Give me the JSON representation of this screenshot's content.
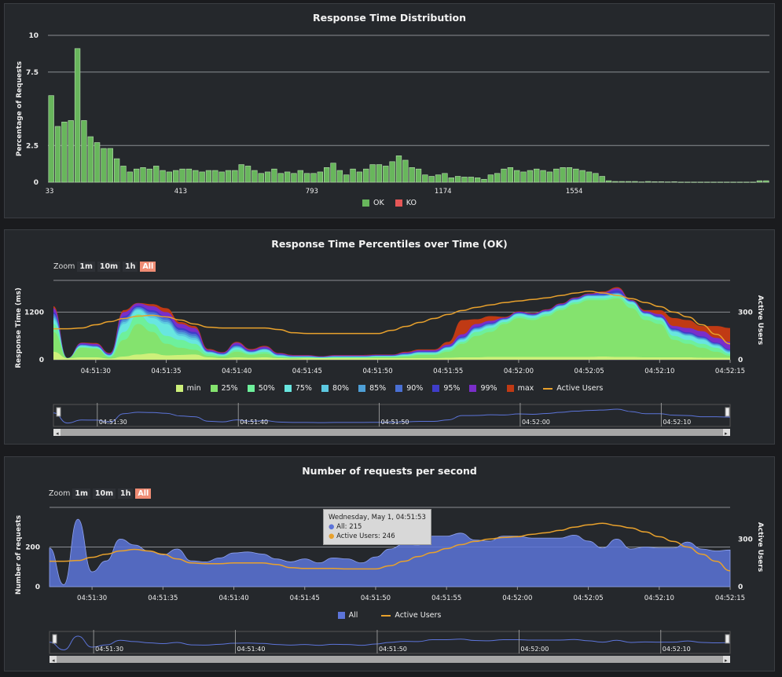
{
  "colors": {
    "ok": "#68b65c",
    "ko": "#e55757",
    "all": "#5c74d9",
    "active": "#e8a12c",
    "min": "#cdf07a",
    "p25": "#84e36e",
    "p50": "#6ef09b",
    "p75": "#68e6e0",
    "p80": "#5cc8e0",
    "p85": "#4e9fd6",
    "p90": "#4a70d4",
    "p95": "#3f3dc9",
    "p99": "#7a2ec9",
    "max": "#c03a14"
  },
  "distribution": {
    "title": "Response Time Distribution",
    "ylabel": "Percentage of Requests",
    "legend": [
      {
        "label": "OK",
        "color": "#68b65c"
      },
      {
        "label": "KO",
        "color": "#e55757"
      }
    ]
  },
  "percentiles": {
    "title": "Response Time Percentiles over Time (OK)",
    "ylabel": "Response Time (ms)",
    "y2label": "Active Users",
    "zoom": {
      "label": "Zoom",
      "buttons": [
        "1m",
        "10m",
        "1h",
        "All"
      ],
      "active": "All"
    },
    "legend": [
      "min",
      "25%",
      "50%",
      "75%",
      "80%",
      "85%",
      "90%",
      "95%",
      "99%",
      "max",
      "Active Users"
    ],
    "legend_keys": [
      "min",
      "p25",
      "p50",
      "p75",
      "p80",
      "p85",
      "p90",
      "p95",
      "p99",
      "max",
      "active"
    ]
  },
  "rps": {
    "title": "Number of requests per second",
    "ylabel": "Number of requests",
    "y2label": "Active Users",
    "zoom": {
      "label": "Zoom",
      "buttons": [
        "1m",
        "10m",
        "1h",
        "All"
      ],
      "active": "All"
    },
    "legend": [
      "All",
      "Active Users"
    ],
    "tooltip": {
      "header": "Wednesday, May 1, 04:51:53",
      "all": "All: 215",
      "active": "Active Users: 246"
    }
  },
  "chart_data": [
    {
      "type": "bar",
      "title": "Response Time Distribution",
      "ylabel": "Percentage of Requests",
      "ylim": [
        0,
        10
      ],
      "yticks": [
        0,
        2.5,
        7.5,
        10
      ],
      "ytick_labels": [
        "0",
        "2.5",
        "7.5",
        "10"
      ],
      "xticks": [
        {
          "v": 0,
          "label": "33"
        },
        {
          "v": 20,
          "label": "413"
        },
        {
          "v": 40,
          "label": "793"
        },
        {
          "v": 60,
          "label": "1174"
        },
        {
          "v": 80,
          "label": "1554"
        }
      ],
      "series": [
        {
          "name": "OK",
          "values": [
            5.9,
            3.8,
            4.1,
            4.2,
            9.1,
            4.2,
            3.1,
            2.7,
            2.3,
            2.3,
            1.6,
            1.1,
            0.7,
            0.9,
            1.0,
            0.9,
            1.1,
            0.8,
            0.7,
            0.8,
            0.9,
            0.9,
            0.8,
            0.7,
            0.8,
            0.8,
            0.7,
            0.8,
            0.8,
            1.2,
            1.1,
            0.8,
            0.6,
            0.7,
            0.9,
            0.6,
            0.7,
            0.6,
            0.8,
            0.6,
            0.6,
            0.7,
            1.0,
            1.3,
            0.8,
            0.5,
            0.9,
            0.7,
            0.9,
            1.2,
            1.2,
            1.1,
            1.4,
            1.8,
            1.5,
            1.0,
            0.9,
            0.5,
            0.4,
            0.5,
            0.6,
            0.3,
            0.4,
            0.35,
            0.35,
            0.3,
            0.2,
            0.5,
            0.6,
            0.9,
            1.0,
            0.8,
            0.7,
            0.8,
            0.9,
            0.8,
            0.7,
            0.9,
            1.0,
            1.0,
            0.9,
            0.8,
            0.7,
            0.6,
            0.4,
            0.1,
            0.05,
            0.05,
            0.05,
            0.05,
            0.02,
            0.05,
            0.03,
            0.03,
            0.02,
            0.03,
            0.01,
            0.01,
            0.01,
            0.01,
            0.01,
            0.01,
            0.01,
            0.01,
            0.01,
            0.01,
            0.01,
            0.01,
            0.1,
            0.1
          ]
        },
        {
          "name": "KO",
          "values": []
        }
      ]
    },
    {
      "type": "area",
      "title": "Response Time Percentiles over Time (OK)",
      "ylabel": "Response Time (ms)",
      "y2label": "Active Users",
      "ylim": [
        0,
        2000
      ],
      "y2lim": [
        0,
        500
      ],
      "yticks": [
        0,
        1200
      ],
      "y2ticks": [
        0,
        300
      ],
      "xlim": [
        0,
        49
      ],
      "x_tick_labels": [
        {
          "t": 3,
          "label": "04:51:30"
        },
        {
          "t": 8,
          "label": "04:51:35"
        },
        {
          "t": 13,
          "label": "04:51:40"
        },
        {
          "t": 18,
          "label": "04:51:45"
        },
        {
          "t": 23,
          "label": "04:51:50"
        },
        {
          "t": 28,
          "label": "04:51:55"
        },
        {
          "t": 33,
          "label": "04:52:00"
        },
        {
          "t": 38,
          "label": "04:52:05"
        },
        {
          "t": 43,
          "label": "04:52:10"
        },
        {
          "t": 48,
          "label": "04:52:15"
        }
      ],
      "x": [
        0,
        1,
        2,
        3,
        4,
        5,
        6,
        7,
        8,
        9,
        10,
        11,
        12,
        13,
        14,
        15,
        16,
        17,
        18,
        19,
        20,
        21,
        22,
        23,
        24,
        25,
        26,
        27,
        28,
        29,
        30,
        31,
        32,
        33,
        34,
        35,
        36,
        37,
        38,
        39,
        40,
        41,
        42,
        43,
        44,
        45,
        46,
        47,
        48
      ],
      "series": [
        {
          "name": "min",
          "values": [
            200,
            40,
            60,
            60,
            30,
            80,
            130,
            160,
            110,
            120,
            130,
            60,
            40,
            60,
            50,
            60,
            40,
            30,
            40,
            40,
            40,
            40,
            40,
            40,
            40,
            40,
            40,
            40,
            50,
            60,
            60,
            70,
            70,
            70,
            70,
            70,
            70,
            70,
            70,
            80,
            70,
            70,
            60,
            60,
            60,
            60,
            50,
            50,
            50
          ]
        },
        {
          "name": "25%",
          "values": [
            700,
            40,
            300,
            280,
            60,
            500,
            900,
            700,
            400,
            300,
            250,
            100,
            80,
            200,
            120,
            150,
            60,
            50,
            50,
            40,
            50,
            50,
            50,
            60,
            60,
            80,
            120,
            120,
            200,
            400,
            600,
            700,
            900,
            1050,
            1000,
            1100,
            1250,
            1400,
            1500,
            1500,
            1550,
            1300,
            1000,
            900,
            500,
            400,
            300,
            200,
            100
          ]
        },
        {
          "name": "50%",
          "values": [
            900,
            40,
            320,
            300,
            80,
            700,
            1150,
            900,
            600,
            500,
            400,
            150,
            100,
            250,
            150,
            200,
            80,
            60,
            60,
            50,
            60,
            60,
            60,
            80,
            80,
            100,
            150,
            150,
            250,
            450,
            700,
            800,
            950,
            1100,
            1050,
            1150,
            1300,
            1450,
            1550,
            1550,
            1600,
            1400,
            1100,
            1000,
            600,
            500,
            400,
            300,
            150
          ]
        },
        {
          "name": "75%",
          "values": [
            1000,
            40,
            350,
            320,
            100,
            900,
            1250,
            1050,
            900,
            600,
            500,
            180,
            120,
            300,
            180,
            250,
            100,
            70,
            70,
            60,
            70,
            70,
            70,
            90,
            90,
            120,
            170,
            170,
            300,
            500,
            750,
            850,
            1000,
            1150,
            1100,
            1200,
            1350,
            1500,
            1600,
            1600,
            1650,
            1450,
            1150,
            1050,
            700,
            600,
            500,
            350,
            180
          ]
        },
        {
          "name": "80%",
          "values": [
            1050,
            40,
            360,
            330,
            110,
            950,
            1280,
            1100,
            950,
            650,
            550,
            190,
            130,
            320,
            190,
            260,
            110,
            80,
            80,
            60,
            80,
            80,
            80,
            95,
            95,
            130,
            180,
            180,
            310,
            520,
            770,
            870,
            1010,
            1160,
            1110,
            1210,
            1360,
            1510,
            1610,
            1610,
            1660,
            1460,
            1160,
            1060,
            720,
            620,
            520,
            370,
            200
          ]
        },
        {
          "name": "85%",
          "values": [
            1100,
            40,
            370,
            340,
            120,
            1000,
            1300,
            1150,
            1000,
            700,
            600,
            200,
            140,
            340,
            200,
            270,
            120,
            85,
            85,
            65,
            85,
            85,
            85,
            100,
            100,
            140,
            190,
            190,
            320,
            540,
            790,
            890,
            1020,
            1170,
            1120,
            1220,
            1370,
            1520,
            1620,
            1620,
            1670,
            1470,
            1170,
            1070,
            740,
            640,
            540,
            390,
            220
          ]
        },
        {
          "name": "90%",
          "values": [
            1150,
            40,
            380,
            350,
            130,
            1050,
            1330,
            1200,
            1050,
            750,
            650,
            210,
            150,
            360,
            210,
            280,
            130,
            90,
            90,
            70,
            90,
            90,
            90,
            105,
            105,
            150,
            200,
            200,
            330,
            560,
            810,
            910,
            1030,
            1180,
            1130,
            1230,
            1380,
            1530,
            1630,
            1640,
            1690,
            1480,
            1180,
            1080,
            760,
            660,
            560,
            410,
            240
          ]
        },
        {
          "name": "95%",
          "values": [
            1200,
            40,
            390,
            360,
            140,
            1100,
            1360,
            1250,
            1100,
            800,
            700,
            220,
            160,
            380,
            220,
            290,
            140,
            95,
            95,
            75,
            95,
            95,
            95,
            110,
            110,
            160,
            210,
            210,
            340,
            580,
            830,
            930,
            1040,
            1190,
            1140,
            1240,
            1390,
            1540,
            1640,
            1680,
            1750,
            1490,
            1190,
            1100,
            790,
            690,
            590,
            430,
            260
          ]
        },
        {
          "name": "99%",
          "values": [
            1300,
            40,
            420,
            400,
            160,
            1200,
            1420,
            1350,
            1200,
            900,
            800,
            250,
            180,
            430,
            250,
            330,
            160,
            110,
            110,
            85,
            110,
            110,
            110,
            125,
            125,
            180,
            240,
            240,
            380,
            640,
            900,
            980,
            1060,
            1210,
            1160,
            1260,
            1410,
            1560,
            1660,
            1700,
            1800,
            1500,
            1220,
            1150,
            850,
            800,
            720,
            550,
            450
          ]
        },
        {
          "name": "max",
          "values": [
            1350,
            40,
            430,
            420,
            170,
            1250,
            1430,
            1400,
            1300,
            950,
            850,
            270,
            190,
            450,
            270,
            350,
            170,
            120,
            120,
            90,
            120,
            120,
            120,
            130,
            130,
            200,
            260,
            260,
            450,
            1000,
            1020,
            1100,
            1080,
            1220,
            1170,
            1270,
            1420,
            1570,
            1670,
            1720,
            1830,
            1510,
            1250,
            1250,
            1050,
            1000,
            850,
            850,
            800
          ]
        },
        {
          "name": "Active Users",
          "axis": "right",
          "values": [
            195,
            195,
            200,
            220,
            240,
            260,
            275,
            280,
            270,
            250,
            225,
            205,
            200,
            200,
            200,
            200,
            190,
            170,
            165,
            165,
            165,
            165,
            165,
            165,
            185,
            210,
            235,
            260,
            285,
            310,
            330,
            345,
            360,
            370,
            380,
            390,
            405,
            420,
            432,
            420,
            405,
            385,
            360,
            335,
            300,
            270,
            220,
            160,
            100
          ]
        }
      ]
    },
    {
      "type": "area",
      "title": "Number of requests per second",
      "ylabel": "Number of requests",
      "y2label": "Active Users",
      "ylim": [
        0,
        400
      ],
      "y2lim": [
        0,
        500
      ],
      "yticks": [
        0,
        200
      ],
      "y2ticks": [
        0,
        300
      ],
      "xlim": [
        0,
        49
      ],
      "x_tick_labels": [
        {
          "t": 3,
          "label": "04:51:30"
        },
        {
          "t": 8,
          "label": "04:51:35"
        },
        {
          "t": 13,
          "label": "04:51:40"
        },
        {
          "t": 18,
          "label": "04:51:45"
        },
        {
          "t": 23,
          "label": "04:51:50"
        },
        {
          "t": 28,
          "label": "04:51:55"
        },
        {
          "t": 33,
          "label": "04:52:00"
        },
        {
          "t": 38,
          "label": "04:52:05"
        },
        {
          "t": 43,
          "label": "04:52:10"
        },
        {
          "t": 48,
          "label": "04:52:15"
        }
      ],
      "x": [
        0,
        1,
        2,
        3,
        4,
        5,
        6,
        7,
        8,
        9,
        10,
        11,
        12,
        13,
        14,
        15,
        16,
        17,
        18,
        19,
        20,
        21,
        22,
        23,
        24,
        25,
        26,
        27,
        28,
        29,
        30,
        31,
        32,
        33,
        34,
        35,
        36,
        37,
        38,
        39,
        40,
        41,
        42,
        43,
        44,
        45,
        46,
        47,
        48
      ],
      "series": [
        {
          "name": "All",
          "values": [
            195,
            10,
            340,
            75,
            130,
            240,
            210,
            180,
            160,
            190,
            130,
            125,
            145,
            170,
            175,
            165,
            140,
            125,
            140,
            120,
            145,
            140,
            120,
            150,
            190,
            215,
            210,
            255,
            255,
            270,
            235,
            230,
            255,
            255,
            245,
            245,
            245,
            260,
            230,
            195,
            240,
            190,
            200,
            195,
            195,
            225,
            190,
            180,
            185
          ]
        },
        {
          "name": "Active Users",
          "axis": "right",
          "values": [
            160,
            160,
            165,
            185,
            205,
            225,
            235,
            225,
            205,
            175,
            150,
            145,
            145,
            150,
            150,
            150,
            140,
            120,
            115,
            115,
            115,
            112,
            112,
            112,
            132,
            160,
            190,
            215,
            240,
            265,
            285,
            300,
            310,
            315,
            330,
            340,
            355,
            375,
            390,
            400,
            385,
            370,
            345,
            315,
            285,
            250,
            205,
            160,
            100
          ]
        }
      ]
    }
  ]
}
